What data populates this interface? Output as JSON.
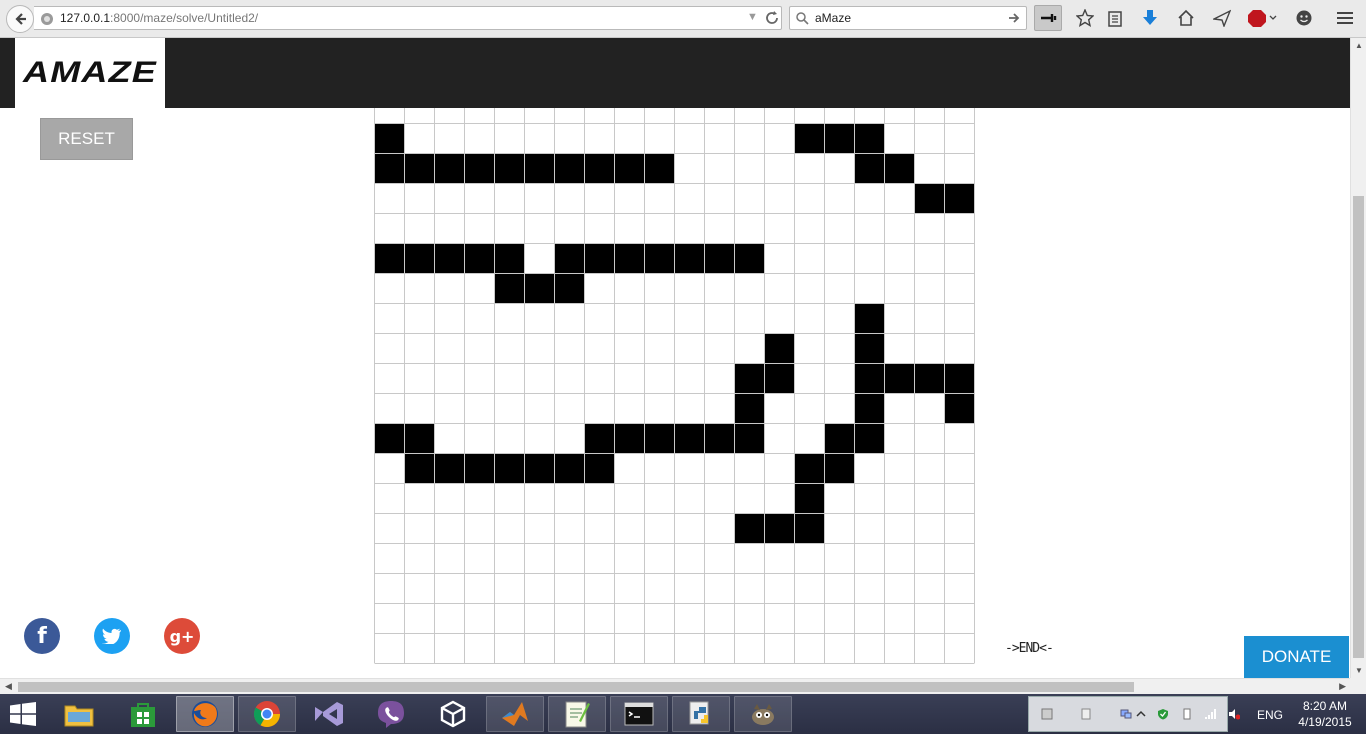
{
  "browser": {
    "url_host": "127.0.0.1",
    "url_rest": ":8000/maze/solve/Untitled2/",
    "search_text": "aMaze"
  },
  "site": {
    "logo": "AMAZE",
    "reset_label": "RESET",
    "end_label": "->END<-",
    "donate_label": "DONATE"
  },
  "social": {
    "facebook_glyph": "f",
    "google_glyph": "g+"
  },
  "maze": {
    "columns": 20,
    "rows": 19,
    "wall_color": "#000000",
    "grid_color": "#c8c8c8",
    "walls": [
      [
        0,
        0
      ],
      [
        14,
        0
      ],
      [
        15,
        0
      ],
      [
        16,
        0
      ],
      [
        0,
        1
      ],
      [
        1,
        1
      ],
      [
        2,
        1
      ],
      [
        3,
        1
      ],
      [
        4,
        1
      ],
      [
        5,
        1
      ],
      [
        6,
        1
      ],
      [
        7,
        1
      ],
      [
        8,
        1
      ],
      [
        9,
        1
      ],
      [
        16,
        1
      ],
      [
        17,
        1
      ],
      [
        18,
        2
      ],
      [
        19,
        2
      ],
      [
        0,
        4
      ],
      [
        1,
        4
      ],
      [
        2,
        4
      ],
      [
        3,
        4
      ],
      [
        4,
        4
      ],
      [
        6,
        4
      ],
      [
        7,
        4
      ],
      [
        8,
        4
      ],
      [
        9,
        4
      ],
      [
        10,
        4
      ],
      [
        11,
        4
      ],
      [
        12,
        4
      ],
      [
        4,
        5
      ],
      [
        5,
        5
      ],
      [
        6,
        5
      ],
      [
        16,
        6
      ],
      [
        13,
        7
      ],
      [
        16,
        7
      ],
      [
        12,
        8
      ],
      [
        13,
        8
      ],
      [
        16,
        8
      ],
      [
        17,
        8
      ],
      [
        18,
        8
      ],
      [
        19,
        8
      ],
      [
        12,
        9
      ],
      [
        16,
        9
      ],
      [
        19,
        9
      ],
      [
        0,
        10
      ],
      [
        1,
        10
      ],
      [
        7,
        10
      ],
      [
        8,
        10
      ],
      [
        9,
        10
      ],
      [
        10,
        10
      ],
      [
        11,
        10
      ],
      [
        12,
        10
      ],
      [
        15,
        10
      ],
      [
        16,
        10
      ],
      [
        1,
        11
      ],
      [
        2,
        11
      ],
      [
        3,
        11
      ],
      [
        4,
        11
      ],
      [
        5,
        11
      ],
      [
        6,
        11
      ],
      [
        7,
        11
      ],
      [
        14,
        11
      ],
      [
        15,
        11
      ],
      [
        14,
        12
      ],
      [
        12,
        13
      ],
      [
        13,
        13
      ],
      [
        14,
        13
      ]
    ],
    "first_row_index": -3
  },
  "taskbar": {
    "language": "ENG",
    "time": "8:20 AM",
    "date": "4/19/2015"
  },
  "colors": {
    "header_bg": "#222222",
    "donate_bg": "#1b8fd1",
    "reset_bg": "#a8a8a8",
    "facebook": "#3b5998",
    "twitter": "#1da1f2",
    "googleplus": "#dd4b39"
  }
}
